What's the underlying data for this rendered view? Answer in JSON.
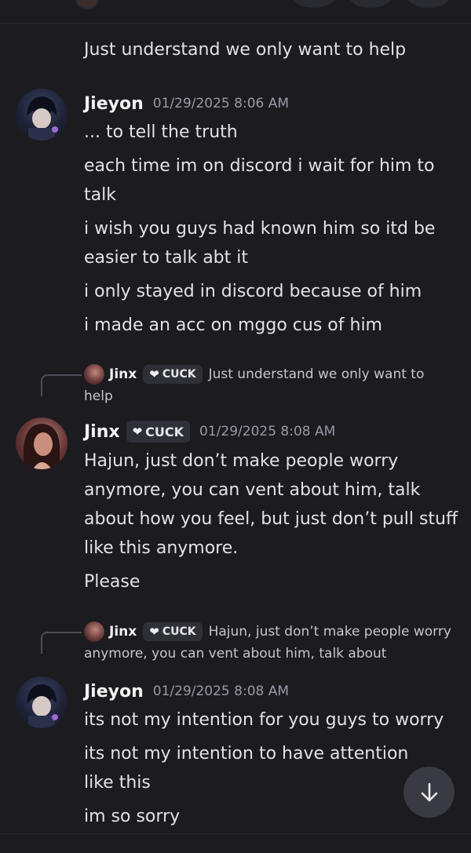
{
  "colors": {
    "background": "#1b1b20",
    "tag_bg": "#2f2f37",
    "timestamp": "#9a9aa6",
    "scroll_button": "#3a3a42"
  },
  "top_message": {
    "text": "Just understand we only want to help"
  },
  "messages": [
    {
      "author": "Jieyon",
      "timestamp": "01/29/2025 8:06 AM",
      "lines": [
        "... to tell the truth",
        "each time im on discord i wait for him to talk",
        "i wish you guys had known him so itd be easier to talk abt it",
        "i only stayed in discord because of him",
        "i made an acc on mggo cus of him"
      ]
    },
    {
      "reply": {
        "author": "Jinx",
        "tag": "CUCK",
        "snippet": "Just understand we only want to help"
      },
      "author": "Jinx",
      "tag": "CUCK",
      "timestamp": "01/29/2025 8:08 AM",
      "lines": [
        "Hajun, just don’t make people worry anymore, you can vent about him, talk about how you feel, but just don’t pull stuff like this anymore.",
        "Please"
      ]
    },
    {
      "reply": {
        "author": "Jinx",
        "tag": "CUCK",
        "snippet": "Hajun, just don’t make people worry anymore, you can vent about him, talk about"
      },
      "author": "Jieyon",
      "timestamp": "01/29/2025 8:08 AM",
      "lines": [
        "its not my intention for you guys to worry",
        "its not my intention to have attention like this",
        "im so sorry"
      ]
    }
  ],
  "icons": {
    "scroll_down": "arrow-down-icon",
    "tag_badge": "heart-icon"
  }
}
